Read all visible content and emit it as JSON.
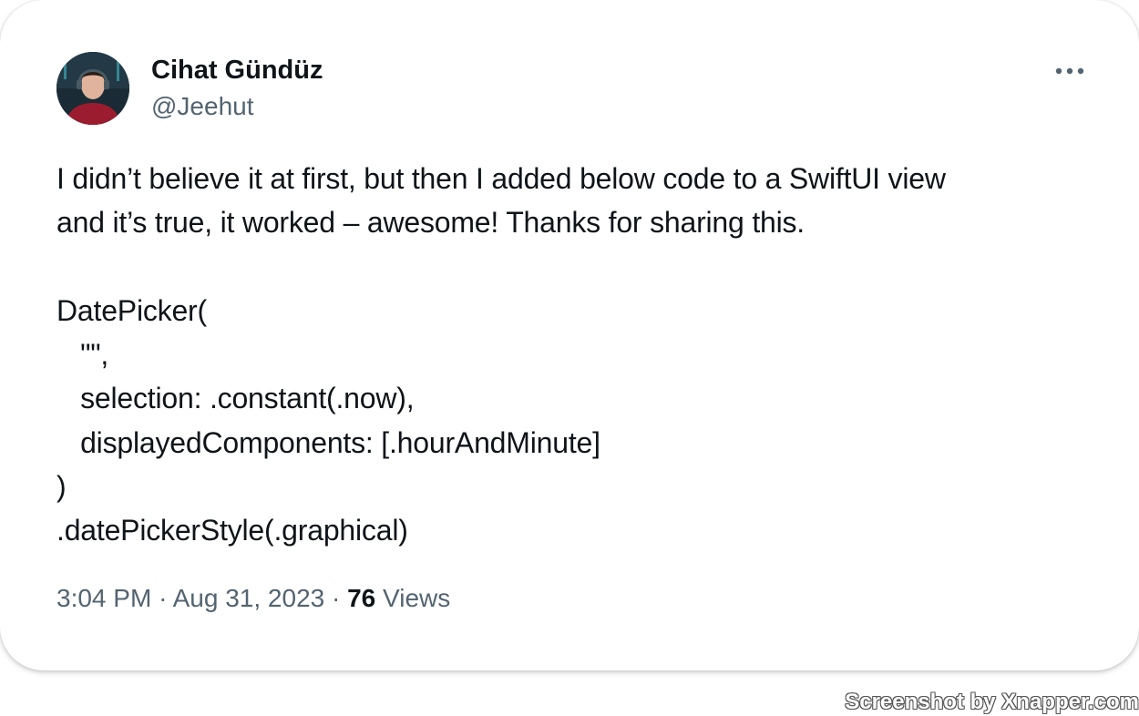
{
  "tweet": {
    "author": {
      "display_name": "Cihat Gündüz",
      "handle": "@Jeehut",
      "avatar_icon": "user-avatar"
    },
    "more_icon": "more-horizontal-icon",
    "text": "I didn’t believe it at first, but then I added below code to a SwiftUI view\nand it’s true, it worked – awesome! Thanks for sharing this.\n\nDatePicker(\n   \"\",\n   selection: .constant(.now),\n   displayedComponents: [.hourAndMinute]\n)\n.datePickerStyle(.graphical)",
    "time": "3:04 PM",
    "separator": "·",
    "date": "Aug 31, 2023",
    "views_count": "76",
    "views_label": "Views"
  },
  "watermark": "Screenshot by Xnapper.com",
  "colors": {
    "primary_text": "#0f1419",
    "secondary_text": "#536471",
    "background": "#ffffff"
  }
}
